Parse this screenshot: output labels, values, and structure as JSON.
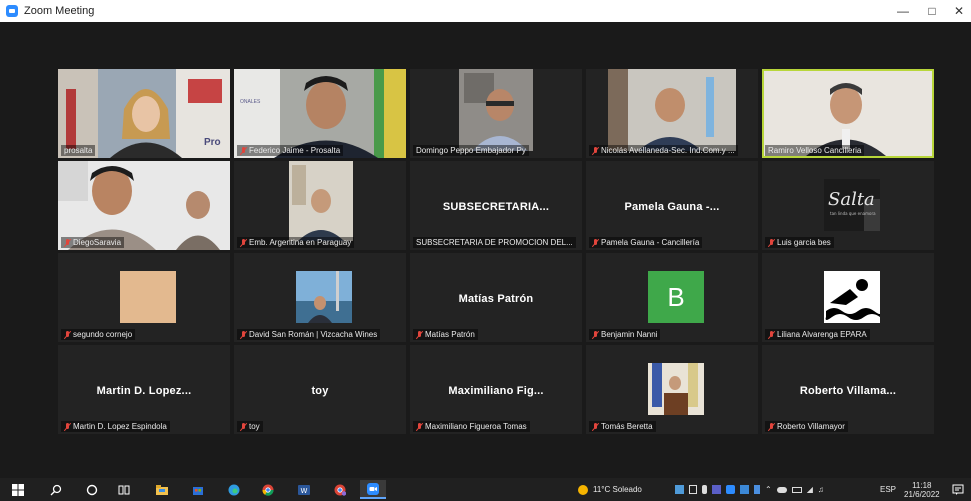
{
  "window": {
    "title": "Zoom Meeting"
  },
  "tiles": [
    {
      "name": "prosalta",
      "muted": false,
      "active": false
    },
    {
      "name": "Federico Jaime - Prosalta",
      "muted": true,
      "active": false
    },
    {
      "name": "Domingo Peppo Embajador Py",
      "muted": false,
      "active": false
    },
    {
      "name": "Nicolás Avellaneda-Sec. Ind.Com.y ...",
      "muted": true,
      "active": false
    },
    {
      "name": "Ramiro Velloso Cancilleria",
      "muted": false,
      "active": true
    },
    {
      "name": "DiegoSaravia",
      "muted": true,
      "active": false
    },
    {
      "name": "Emb. Argentina en Paraguay",
      "muted": true,
      "active": false
    },
    {
      "name": "SUBSECRETARIA DE PROMOCION DEL...",
      "big": "SUBSECRETARIA...",
      "muted": false,
      "active": false
    },
    {
      "name": "Pamela Gauna - Cancillería",
      "big": "Pamela Gauna -...",
      "muted": true,
      "active": false
    },
    {
      "name": "Luis garcia bes",
      "muted": true,
      "active": false
    },
    {
      "name": "segundo cornejo",
      "muted": true,
      "active": false
    },
    {
      "name": "David San Román | Vizcacha Wines",
      "muted": true,
      "active": false
    },
    {
      "name": "Matías Patrón",
      "big": "Matías Patrón",
      "muted": true,
      "active": false
    },
    {
      "name": "Benjamin Nanni",
      "avatar_letter": "B",
      "muted": true,
      "active": false
    },
    {
      "name": "Liliana Alvarenga EPARA",
      "muted": true,
      "active": false
    },
    {
      "name": "Martin D. Lopez Espindola",
      "big": "Martin D. Lopez...",
      "muted": true,
      "active": false
    },
    {
      "name": "toy",
      "big": "toy",
      "muted": true,
      "active": false
    },
    {
      "name": "Maximiliano Figueroa Tomas",
      "big": "Maximiliano Fig...",
      "muted": true,
      "active": false
    },
    {
      "name": "Tomás Beretta",
      "muted": true,
      "active": false
    },
    {
      "name": "Roberto Villamayor",
      "big": "Roberto Villama...",
      "muted": true,
      "active": false
    }
  ],
  "logo_text": "Salta",
  "logo_sub": "tan linda que enamora",
  "tile_snippets": {
    "prosalta_sign": "Pro",
    "jaime_sign": "ONALES"
  },
  "taskbar": {
    "weather": "11°C  Soleado",
    "lang": "ESP",
    "time": "11:18",
    "date": "21/6/2022"
  },
  "colors": {
    "active_border": "#b8d63a",
    "muted": "#e2453c",
    "avatar_green": "#3fa84a",
    "zoom_blue": "#2d8cff"
  }
}
